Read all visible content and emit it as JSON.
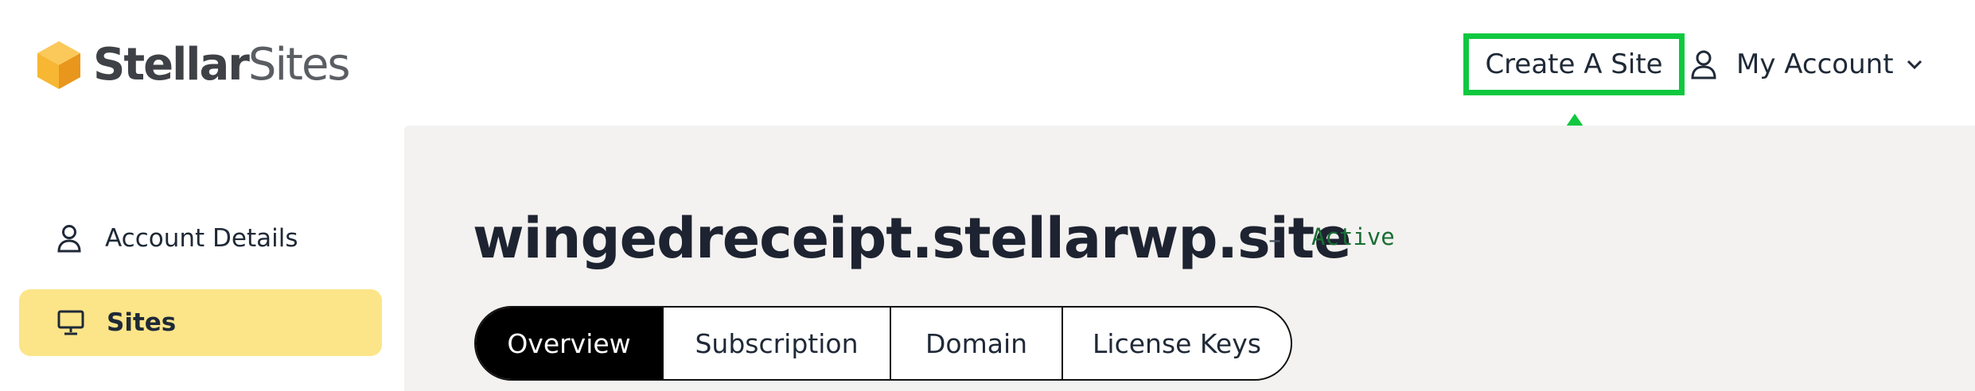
{
  "brand": {
    "logo_bold": "Stellar",
    "logo_light": "Sites",
    "accent": "#f5a623"
  },
  "header": {
    "create_site_label": "Create A Site",
    "account_label": "My Account",
    "highlight_color": "#10c83f"
  },
  "sidebar": {
    "items": [
      {
        "label": "Account Details",
        "icon": "user-icon",
        "active": false
      },
      {
        "label": "Sites",
        "icon": "monitor-icon",
        "active": true
      }
    ],
    "active_color": "#fce588"
  },
  "site": {
    "domain": "wingedreceipt.stellarwp.site",
    "separator": "–",
    "status": "Active",
    "status_color": "#1a6d34"
  },
  "tabs": [
    {
      "label": "Overview",
      "active": true
    },
    {
      "label": "Subscription",
      "active": false
    },
    {
      "label": "Domain",
      "active": false
    },
    {
      "label": "License Keys",
      "active": false
    }
  ]
}
